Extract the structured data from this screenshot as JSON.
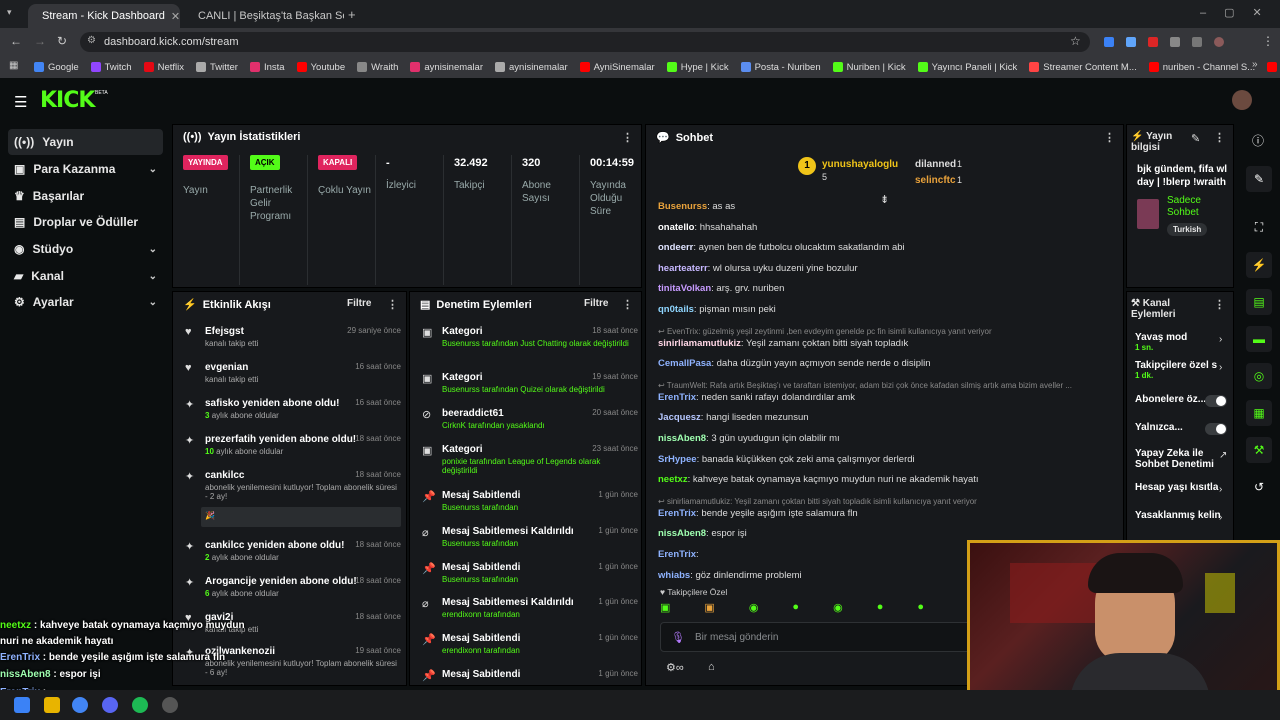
{
  "browser": {
    "tabs": [
      {
        "title": "Stream - Kick Dashboard"
      },
      {
        "title": "CANLI | Beşiktaş'ta Başkan Seri"
      }
    ],
    "url": "dashboard.kick.com/stream",
    "bookmarks": [
      "Google",
      "Twitch",
      "Netflix",
      "Twitter",
      "Insta",
      "Youtube",
      "Wraith",
      "aynisinemalar",
      "aynisinemalar",
      "AyniSinemalar",
      "Hype | Kick",
      "Posta - Nuriben",
      "Nuriben | Kick",
      "Yayıncı Paneli | Kick",
      "Streamer Content M...",
      "nuriben - Channel S...",
      "Aynı Sinemalar - Ça..."
    ]
  },
  "logo": "KICK",
  "logo_sup": "BETA",
  "sidebar": {
    "items": [
      {
        "label": "Yayın",
        "icon": "broadcast-icon"
      },
      {
        "label": "Para Kazanma",
        "icon": "money-icon"
      },
      {
        "label": "Başarılar",
        "icon": "trophy-icon"
      },
      {
        "label": "Droplar ve Ödüller",
        "icon": "gift-icon"
      },
      {
        "label": "Stüdyo",
        "icon": "studio-icon"
      },
      {
        "label": "Kanal",
        "icon": "channel-icon"
      },
      {
        "label": "Ayarlar",
        "icon": "gear-icon"
      }
    ]
  },
  "stats": {
    "title": "Yayın İstatistikleri",
    "cols": [
      {
        "badge": "YAYINDA",
        "badge_color": "#e0245e",
        "label": "Yayın"
      },
      {
        "badge": "AÇIK",
        "badge_color": "#53fc18",
        "label": "Partnerlik Gelir Programı"
      },
      {
        "badge": "KAPALI",
        "badge_color": "#e0245e",
        "label": "Çoklu Yayın"
      },
      {
        "value": "-",
        "label": "İzleyici"
      },
      {
        "value": "32.492",
        "label": "Takipçi"
      },
      {
        "value": "320",
        "label": "Abone Sayısı"
      },
      {
        "value": "00:14:59",
        "label": "Yayında Olduğu Süre"
      }
    ]
  },
  "activity": {
    "title": "Etkinlik Akışı",
    "filter": "Filtre",
    "items": [
      {
        "title": "Efejsgst",
        "sub": "kanalı takip etti",
        "time": "29 saniye önce",
        "icon": "heart-icon"
      },
      {
        "title": "evgenian",
        "sub": "kanalı takip etti",
        "time": "16 saat önce",
        "icon": "heart-icon"
      },
      {
        "title": "safisko yeniden abone oldu!",
        "sub": "aylık abone oldular",
        "num": "3",
        "time": "16 saat önce",
        "icon": "sparkle-icon"
      },
      {
        "title": "prezerfatih yeniden abone oldu!",
        "sub": "aylık abone oldular",
        "num": "10",
        "time": "18 saat önce",
        "icon": "sparkle-icon"
      },
      {
        "title": "cankilcc",
        "sub": "abonelik yenilemesini kutluyor! Toplam abonelik süresi - 2 ay!",
        "time": "18 saat önce",
        "icon": "sparkle-icon"
      },
      {
        "title": "cankilcc yeniden abone oldu!",
        "sub": "aylık abone oldular",
        "num": "2",
        "time": "18 saat önce",
        "icon": "sparkle-icon"
      },
      {
        "title": "Arogancije yeniden abone oldu!",
        "sub": "aylık abone oldular",
        "num": "6",
        "time": "18 saat önce",
        "icon": "sparkle-icon"
      },
      {
        "title": "gavi2i",
        "sub": "kanalı takip etti",
        "time": "18 saat önce",
        "icon": "heart-icon"
      },
      {
        "title": "ozilwankenozii",
        "sub": "abonelik yenilemesini kutluyor! Toplam abonelik süresi - 6 ay!",
        "time": "19 saat önce",
        "icon": "sparkle-icon"
      }
    ]
  },
  "moderation": {
    "title": "Denetim Eylemleri",
    "filter": "Filtre",
    "items": [
      {
        "title": "Kategori",
        "sub": "Busenurss tarafından Just Chatting olarak değiştirildi",
        "time": "18 saat önce",
        "icon": "category-icon"
      },
      {
        "title": "Kategori",
        "sub": "Busenurss tarafından Quizei olarak değiştirildi",
        "time": "19 saat önce",
        "icon": "category-icon"
      },
      {
        "title": "beeraddict61",
        "sub": "CirknK tarafından yasaklandı",
        "time": "20 saat önce",
        "icon": "ban-icon"
      },
      {
        "title": "Kategori",
        "sub": "ponixie tarafından League of Legends olarak değiştirildi",
        "time": "23 saat önce",
        "icon": "category-icon"
      },
      {
        "title": "Mesaj Sabitlendi",
        "sub": "Busenurss tarafından",
        "time": "1 gün önce",
        "icon": "pin-icon"
      },
      {
        "title": "Mesaj Sabitlemesi Kaldırıldı",
        "sub": "Busenurss tarafından",
        "time": "1 gün önce",
        "icon": "unpin-icon"
      },
      {
        "title": "Mesaj Sabitlendi",
        "sub": "Busenurss tarafından",
        "time": "1 gün önce",
        "icon": "pin-icon"
      },
      {
        "title": "Mesaj Sabitlemesi Kaldırıldı",
        "sub": "erendixonn tarafından",
        "time": "1 gün önce",
        "icon": "unpin-icon"
      },
      {
        "title": "Mesaj Sabitlendi",
        "sub": "erendixonn tarafından",
        "time": "1 gün önce",
        "icon": "pin-icon"
      },
      {
        "title": "Mesaj Sabitlendi",
        "sub": "",
        "time": "1 gün önce",
        "icon": "pin-icon"
      }
    ]
  },
  "chat": {
    "title": "Sohbet",
    "top_gifters": [
      {
        "name": "yunushayaloglu",
        "count": "5"
      },
      {
        "name": "dilanned",
        "count": "1"
      },
      {
        "name": "selincftc",
        "count": "1"
      }
    ],
    "messages": [
      {
        "user": "Busenurss",
        "color": "#e9a23b",
        "text": "as as"
      },
      {
        "user": "onatello",
        "color": "#ffffff",
        "text": "hhsahahahah"
      },
      {
        "user": "ondeerr",
        "color": "#dfe3ff",
        "text": "aynen ben de futbolcu olucaktım sakatlandım abi"
      },
      {
        "user": "hearteaterr",
        "color": "#c7b8ff",
        "text": "wl olursa uyku duzeni yine bozulur"
      },
      {
        "user": "tinitaVolkan",
        "color": "#c79bff",
        "text": "arş. grv. nuriben"
      },
      {
        "user": "qn0tails",
        "color": "#8fd6ff",
        "text": "pişman mısın peki"
      },
      {
        "reply": "EvenTrix: güzelmiş yeşil zeytinmi ,ben evdeyim genelde pc fin isimli kullanıcıya yanıt veriyor"
      },
      {
        "user": "sinirliamamutlukiz",
        "color": "#ffd6e5",
        "text": "Yeşil zamanı çoktan bitti siyah topladık"
      },
      {
        "user": "CemallPasa",
        "color": "#8fb3ff",
        "text": "daha düzgün yayın açmıyon sende nerde o disiplin"
      },
      {
        "reply": "TraumWelt: Rafa artık Beşiktaş'ı ve taraftarı istemiyor, adam bizi çok önce kafadan silmiş artık ama bizim aveller ..."
      },
      {
        "user": "ErenTrix",
        "color": "#8fb3ff",
        "text": "neden sanki rafayı dolandırdılar amk"
      },
      {
        "user": "Jacquesz",
        "color": "#b6c7ff",
        "text": "hangi liseden mezunsun"
      },
      {
        "user": "nissAben8",
        "color": "#9fffb0",
        "text": "3 gün uyudugun için olabilir mı"
      },
      {
        "user": "SrHypee",
        "color": "#8fb3ff",
        "text": "banada küçükken çok zeki ama çalışmıyor derlerdi"
      },
      {
        "user": "neetxz",
        "color": "#53fc18",
        "text": "kahveye batak oynamaya kaçmıyo muydun nuri ne akademik hayatı"
      },
      {
        "reply": "sinirliamamutlukiz: Yeşil zamanı çoktan bitti siyah topladık isimli kullanıcıya yanıt veriyor"
      },
      {
        "user": "ErenTrix",
        "color": "#8fb3ff",
        "text": "bende yeşile aşığım işte salamura fln"
      },
      {
        "user": "nissAben8",
        "color": "#9fffb0",
        "text": "espor işi"
      },
      {
        "user": "ErenTrix",
        "color": "#8fb3ff",
        "text": ""
      },
      {
        "user": "whiabs",
        "color": "#8fb3ff",
        "text": "göz dinlendirme problemi"
      }
    ],
    "follower_label": "Takipçilere Özel",
    "input_placeholder": "Bir mesaj gönderin"
  },
  "stream_info": {
    "title": "Yayın bilgisi",
    "stream_title": "bjk gündem, fifa wl day | !blerp !wraith",
    "category": "Sadece Sohbet",
    "tag": "Turkish"
  },
  "channel_actions": {
    "title": "Kanal Eylemleri",
    "items": [
      {
        "label": "Yavaş mod",
        "sub": "1 sn.",
        "control": "chevron"
      },
      {
        "label": "Takipçilere özel s",
        "sub": "1 dk.",
        "control": "chevron"
      },
      {
        "label": "Abonelere öz...",
        "control": "toggle"
      },
      {
        "label": "Yalnızca...",
        "control": "toggle"
      },
      {
        "label": "Yapay Zeka ile Sohbet Denetimi",
        "control": "external"
      },
      {
        "label": "Hesap yaşı kısıtla",
        "control": "chevron"
      },
      {
        "label": "Yasaklanmış kelin",
        "control": "chevron"
      }
    ]
  },
  "overlay": [
    {
      "user": "neetxz",
      "color": "#53fc18",
      "text": "kahveye batak oynamaya kaçmıyo muydun nuri ne akademik hayatı"
    },
    {
      "user": "ErenTrix",
      "color": "#8fb3ff",
      "text": "bende yeşile aşığım işte salamura fln"
    },
    {
      "user": "nissAben8",
      "color": "#9fffb0",
      "text": "espor işi"
    },
    {
      "user": "ErenTrix",
      "color": "#8fb3ff",
      "text": ""
    },
    {
      "user": "whiabs",
      "color": "#8fb3ff",
      "text": "göz dinlendirme problemi"
    }
  ],
  "colors": {
    "accent": "#53fc18",
    "live": "#e0245e",
    "panel": "#17191c"
  }
}
